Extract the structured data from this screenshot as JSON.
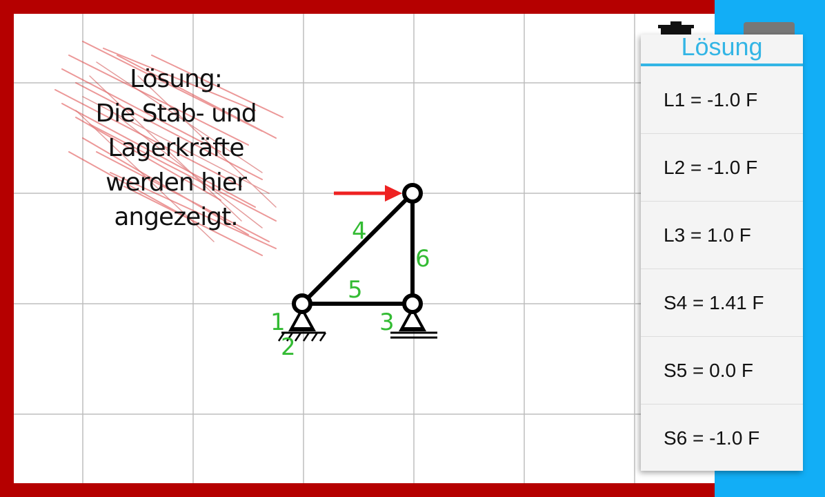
{
  "hint": {
    "lines": [
      "Lösung:",
      "Die Stab- und",
      "Lagerkräfte",
      "werden hier",
      "angezeigt."
    ]
  },
  "diagram": {
    "labels": [
      "1",
      "2",
      "3",
      "4",
      "5",
      "6"
    ],
    "label_color": "#33bb33",
    "force_color": "#ee2222"
  },
  "panel": {
    "title": "Lösung",
    "results": [
      "L1 = -1.0 F",
      "L2 = -1.0 F",
      "L3 = 1.0 F",
      "S4 = 1.41 F",
      "S5 = 0.0 F",
      "S6 = -1.0 F"
    ]
  },
  "colors": {
    "frame": "#b50000",
    "accent": "#33b5e5",
    "side": "#12aef6"
  }
}
